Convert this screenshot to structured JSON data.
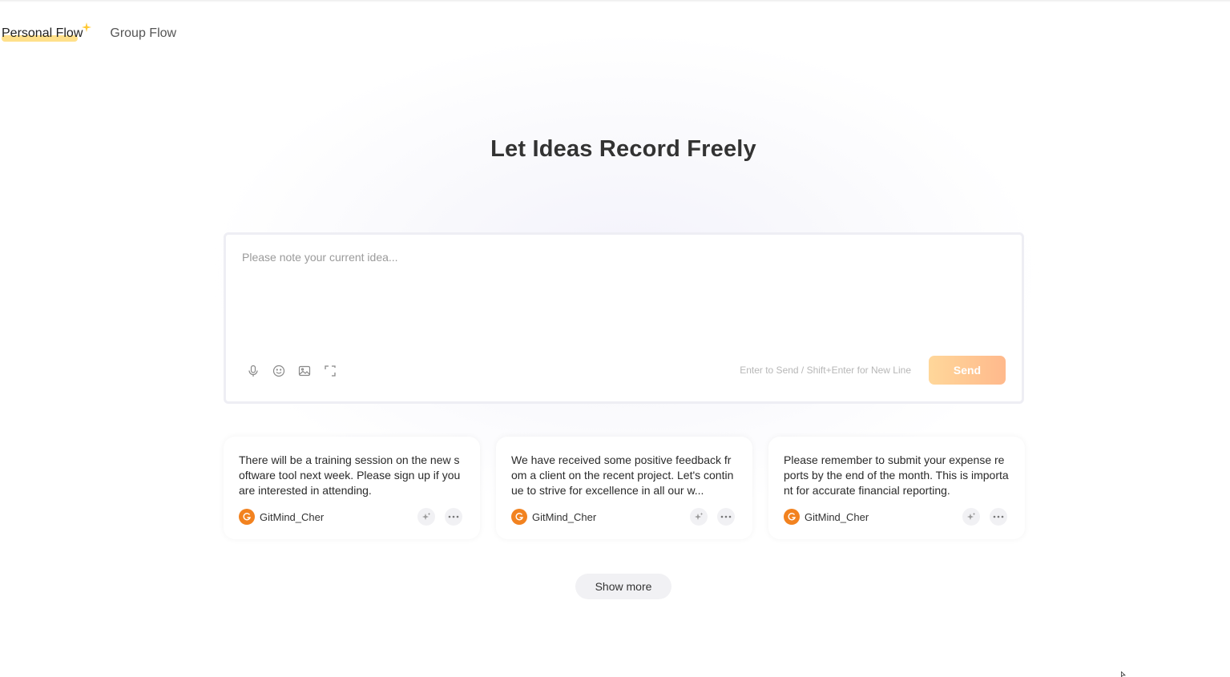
{
  "nav": {
    "tabs": [
      {
        "label": "Personal Flow",
        "active": true
      },
      {
        "label": "Group Flow",
        "active": false
      }
    ]
  },
  "hero": {
    "title": "Let Ideas Record Freely"
  },
  "editor": {
    "placeholder": "Please note your current idea...",
    "value": "",
    "tools": [
      "microphone-icon",
      "emoji-icon",
      "image-icon",
      "expand-icon"
    ],
    "hint": "Enter to Send / Shift+Enter for New Line",
    "send_label": "Send"
  },
  "cards": [
    {
      "text": "There will be a training session on the new software tool next week. Please sign up if you are interested in attending.",
      "author": "GitMind_Cher"
    },
    {
      "text": "We have received some positive feedback from a client on the recent project. Let's continue to strive for excellence in all our w...",
      "author": "GitMind_Cher"
    },
    {
      "text": "Please remember to submit your expense reports by the end of the month. This is important for accurate financial reporting.",
      "author": "GitMind_Cher"
    }
  ],
  "show_more_label": "Show more",
  "colors": {
    "accent_yellow": "#ffe08a",
    "send_gradient_start": "#ffd79a",
    "send_gradient_end": "#ffb98c",
    "avatar_orange": "#f2821f"
  }
}
